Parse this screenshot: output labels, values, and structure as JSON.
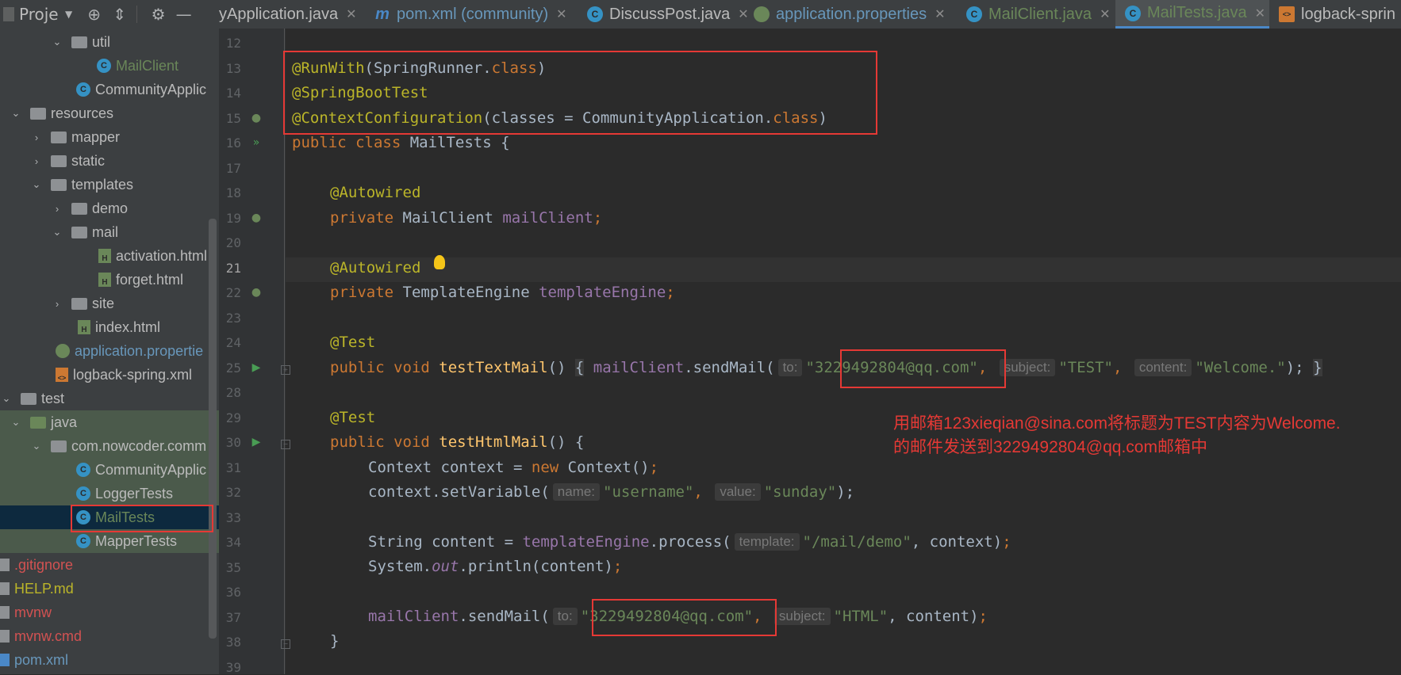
{
  "tabs": [
    {
      "label": "yApplication.java",
      "icon": "java-class-icon"
    },
    {
      "label": "pom.xml (community)",
      "icon": "maven-icon"
    },
    {
      "label": "DiscussPost.java",
      "icon": "java-class-icon"
    },
    {
      "label": "application.properties",
      "icon": "spring-config-icon"
    },
    {
      "label": "MailClient.java",
      "icon": "java-class-icon"
    },
    {
      "label": "MailTests.java",
      "icon": "java-test-class-icon",
      "active": true
    },
    {
      "label": "logback-sprin",
      "icon": "xml-icon"
    }
  ],
  "project_panel": {
    "title": "Proje",
    "tree": [
      {
        "label": "util",
        "type": "package-folder",
        "expanded": true
      },
      {
        "label": "MailClient",
        "type": "java-class"
      },
      {
        "label": "CommunityApplic",
        "type": "spring-boot-app"
      },
      {
        "label": "resources",
        "type": "resources-folder",
        "expanded": true
      },
      {
        "label": "mapper",
        "type": "folder"
      },
      {
        "label": "static",
        "type": "folder"
      },
      {
        "label": "templates",
        "type": "folder",
        "expanded": true
      },
      {
        "label": "demo",
        "type": "folder"
      },
      {
        "label": "mail",
        "type": "folder",
        "expanded": true
      },
      {
        "label": "activation.html",
        "type": "html-file"
      },
      {
        "label": "forget.html",
        "type": "html-file"
      },
      {
        "label": "site",
        "type": "folder"
      },
      {
        "label": "index.html",
        "type": "html-file"
      },
      {
        "label": "application.propertie",
        "type": "spring-config"
      },
      {
        "label": "logback-spring.xml",
        "type": "xml-file"
      },
      {
        "label": "test",
        "type": "folder",
        "expanded": true
      },
      {
        "label": "java",
        "type": "test-source-folder",
        "expanded": true
      },
      {
        "label": "com.nowcoder.comm",
        "type": "package-folder",
        "expanded": true
      },
      {
        "label": "CommunityApplic",
        "type": "java-test-class"
      },
      {
        "label": "LoggerTests",
        "type": "java-test-class"
      },
      {
        "label": "MailTests",
        "type": "java-test-class",
        "selected": true
      },
      {
        "label": "MapperTests",
        "type": "java-test-class"
      },
      {
        "label": ".gitignore",
        "type": "ignored-file"
      },
      {
        "label": "HELP.md",
        "type": "md-file"
      },
      {
        "label": "mvnw",
        "type": "ignored-file"
      },
      {
        "label": "mvnw.cmd",
        "type": "ignored-file"
      },
      {
        "label": "pom.xml",
        "type": "maven-file"
      }
    ]
  },
  "editor": {
    "line_numbers": [
      "12",
      "13",
      "14",
      "15",
      "16",
      "17",
      "18",
      "19",
      "20",
      "21",
      "22",
      "23",
      "24",
      "25",
      "28",
      "29",
      "30",
      "31",
      "32",
      "33",
      "34",
      "35",
      "36",
      "37",
      "38",
      "39"
    ],
    "code": {
      "l13_ann": "@RunWith",
      "l13_rest": "(SpringRunner.",
      "l13_kw": "class",
      "l13_end": ")",
      "l14": "@SpringBootTest",
      "l15_ann": "@ContextConfiguration",
      "l15_rest": "(classes = CommunityApplication.",
      "l15_kw": "class",
      "l15_end": ")",
      "l16_kw": "public class ",
      "l16_rest": "MailTests {",
      "l18": "@Autowired",
      "l19_kw": "private ",
      "l19_type": "MailClient ",
      "l19_fld": "mailClient",
      "l19_end": ";",
      "l21": "@Autowired",
      "l22_kw": "private ",
      "l22_type": "TemplateEngine ",
      "l22_fld": "templateEngine",
      "l22_end": ";",
      "l24": "@Test",
      "l25_kw": "public void ",
      "l25_mth": "testTextMail",
      "l25_p": "() ",
      "l25_brace": "{",
      "l25_fld": "mailClient",
      "l25_call": ".sendMail(",
      "l25_hint_to": "to:",
      "l25_str_to": "\"3229492804@qq.com\"",
      "l25_comma1": ", ",
      "l25_hint_subject": "subject:",
      "l25_str_subject": "\"TEST\"",
      "l25_comma2": ", ",
      "l25_hint_content": "content:",
      "l25_str_content": "\"Welcome.\"",
      "l25_end": ");",
      "l25_close": "}",
      "l29": "@Test",
      "l30_kw": "public void ",
      "l30_mth": "testHtmlMail",
      "l30_rest": "() {",
      "l31_a": "Context context = ",
      "l31_kw": "new ",
      "l31_b": "Context()",
      "l31_end": ";",
      "l32_a": "context.setVariable(",
      "l32_hint_name": "name:",
      "l32_str_name": "\"username\"",
      "l32_comma": ", ",
      "l32_hint_value": "value:",
      "l32_str_value": "\"sunday\"",
      "l32_end": ");",
      "l34_a": "String content = ",
      "l34_fld": "templateEngine",
      "l34_b": ".process(",
      "l34_hint": "template:",
      "l34_str": "\"/mail/demo\"",
      "l34_c": ", context)",
      "l34_end": ";",
      "l35_a": "System.",
      "l35_out": "out",
      "l35_b": ".println(content)",
      "l35_end": ";",
      "l37_fld": "mailClient",
      "l37_call": ".sendMail(",
      "l37_hint_to": "to:",
      "l37_str_to": "\"3229492804@qq.com\"",
      "l37_comma": ", ",
      "l37_hint_subject": "subject:",
      "l37_str_subject": "\"HTML\"",
      "l37_c": ", content)",
      "l37_end": ";",
      "l38": "}"
    }
  },
  "annotation_note": {
    "line1": "用邮箱123xieqian@sina.com将标题为TEST内容为Welcome.",
    "line2": "的邮件发送到3229492804@qq.com邮箱中"
  },
  "colors": {
    "editor_bg": "#2b2b2b",
    "sidebar_bg": "#3c3f41",
    "annotation": "#bbb529",
    "keyword": "#cc7832",
    "string": "#6a8759",
    "field": "#9876aa",
    "method": "#ffc66d",
    "highlight_box": "#e53935"
  }
}
